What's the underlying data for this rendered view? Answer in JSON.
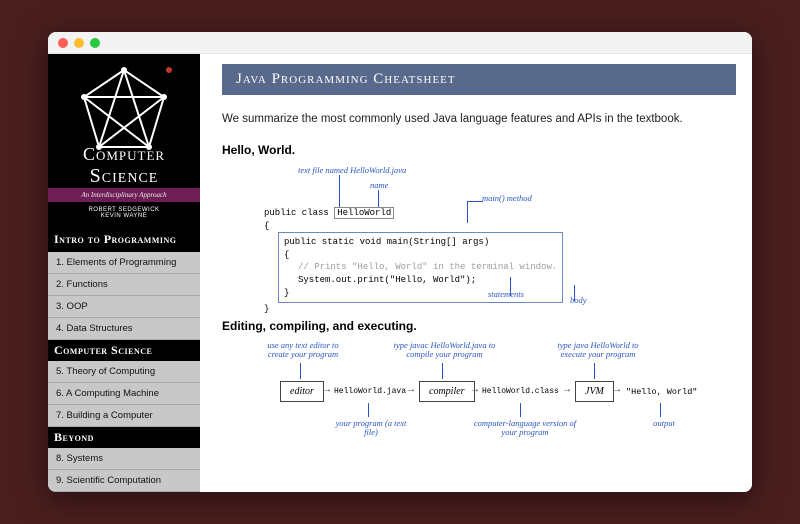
{
  "book": {
    "title_line1": "Computer",
    "title_line2": "Science",
    "subtitle": "An Interdisciplinary Approach",
    "author1": "ROBERT SEDGEWICK",
    "author2": "KEVIN WAYNE"
  },
  "sidebar": {
    "sections": [
      {
        "heading": "Intro to Programming",
        "items": [
          "1.  Elements of Programming",
          "2.  Functions",
          "3.  OOP",
          "4.  Data Structures"
        ]
      },
      {
        "heading": "Computer Science",
        "items": [
          "5.  Theory of Computing",
          "6.  A Computing Machine",
          "7.  Building a Computer"
        ]
      },
      {
        "heading": "Beyond",
        "items": [
          "8.  Systems",
          "9.  Scientific Computation"
        ]
      }
    ]
  },
  "page": {
    "title": "Java Programming Cheatsheet",
    "intro": "We summarize the most commonly used Java language features and APIs in the textbook.",
    "section1_title": "Hello, World.",
    "section2_title": "Editing, compiling, and executing."
  },
  "fig1": {
    "annot_textfile": "text file named  HelloWorld.java",
    "annot_name": "name",
    "annot_main": "main() method",
    "code_l1_pre": "public class ",
    "code_l1_name": "HelloWorld",
    "code_l2": "{",
    "code_l3": "public static void main(String[] args)",
    "code_l4": "{",
    "code_l5_comment": "// Prints \"Hello, World\" in the terminal window.",
    "code_l6": "System.out.print(\"Hello, World\");",
    "code_l7": "}",
    "code_l8": "}",
    "annot_statements": "statements",
    "annot_body": "body"
  },
  "fig2": {
    "annot_editor_top": "use any text editor to create your program",
    "annot_compiler_top": "type  javac HelloWorld.java to compile your program",
    "annot_jvm_top": "type  java HelloWorld to execute your program",
    "stage_editor": "editor",
    "stage_compiler": "compiler",
    "stage_jvm": "JVM",
    "arrow1_text": "HelloWorld.java",
    "arrow2_text": "HelloWorld.class",
    "output_text": "\"Hello, World\"",
    "annot_editor_bottom": "your program (a text file)",
    "annot_compiler_bottom": "computer-language version of your program",
    "annot_output_bottom": "output"
  }
}
